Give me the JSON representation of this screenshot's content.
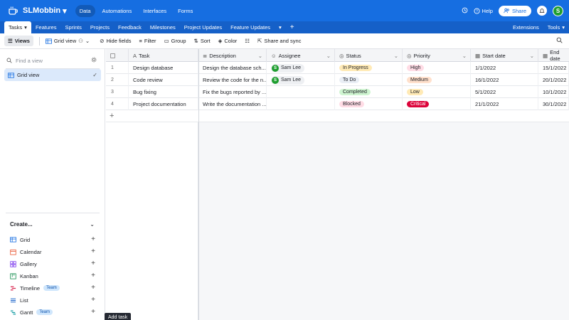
{
  "app": {
    "base_name": "SLMobbin",
    "nav": [
      "Data",
      "Automations",
      "Interfaces",
      "Forms"
    ],
    "help_label": "Help",
    "share_label": "Share",
    "user_initial": "S"
  },
  "tables": {
    "active": "Tasks",
    "items": [
      "Features",
      "Sprints",
      "Projects",
      "Feedback",
      "Milestones",
      "Project Updates",
      "Feature Updates"
    ],
    "extensions_label": "Extensions",
    "tools_label": "Tools"
  },
  "toolbar": {
    "views_label": "Views",
    "gridview_label": "Grid view",
    "hide_fields": "Hide fields",
    "filter": "Filter",
    "group": "Group",
    "sort": "Sort",
    "color": "Color",
    "share_sync": "Share and sync"
  },
  "sidebar": {
    "find_placeholder": "Find a view",
    "current_view": "Grid view",
    "create_label": "Create...",
    "create_items": [
      {
        "label": "Grid",
        "icon": "grid-icon",
        "color": "#166ee1",
        "team": ""
      },
      {
        "label": "Calendar",
        "icon": "calendar-icon",
        "color": "#e8542f",
        "team": ""
      },
      {
        "label": "Gallery",
        "icon": "gallery-icon",
        "color": "#7c3aed",
        "team": ""
      },
      {
        "label": "Kanban",
        "icon": "kanban-icon",
        "color": "#0f8a4a",
        "team": ""
      },
      {
        "label": "Timeline",
        "icon": "timeline-icon",
        "color": "#d9264f",
        "team": "Team"
      },
      {
        "label": "List",
        "icon": "list-icon",
        "color": "#1560c8",
        "team": ""
      },
      {
        "label": "Gantt",
        "icon": "gantt-icon",
        "color": "#0e9aa0",
        "team": "Team"
      }
    ]
  },
  "grid": {
    "columns": [
      "Task",
      "Description",
      "Assignee",
      "Status",
      "Priority",
      "Start date",
      "End date"
    ],
    "rows": [
      {
        "num": "1",
        "task": "Design database",
        "description": "Design the database sch...",
        "assignee": "Sam Lee",
        "status": "In Progress",
        "priority": "High",
        "start": "1/1/2022",
        "end": "15/1/2022"
      },
      {
        "num": "2",
        "task": "Code review",
        "description": "Review the code for the n...",
        "assignee": "Sam Lee",
        "status": "To Do",
        "priority": "Medium",
        "start": "16/1/2022",
        "end": "20/1/2022"
      },
      {
        "num": "3",
        "task": "Bug fixing",
        "description": "Fix the bugs reported by ...",
        "assignee": "",
        "status": "Completed",
        "priority": "Low",
        "start": "5/1/2022",
        "end": "10/1/2022"
      },
      {
        "num": "4",
        "task": "Project documentation",
        "description": "Write the documentation ...",
        "assignee": "",
        "status": "Blocked",
        "priority": "Critical",
        "start": "21/1/2022",
        "end": "30/1/2022"
      }
    ],
    "status_colors": {
      "In Progress": "#ffeab6",
      "To Do": "#e9eef5",
      "Completed": "#cff5d1",
      "Blocked": "#ffdce5"
    },
    "priority_colors": {
      "High": "#ffdce5",
      "Medium": "#ffe0cc",
      "Low": "#ffeab6",
      "Critical": "#dc043b"
    },
    "tooltip": "Add task"
  }
}
